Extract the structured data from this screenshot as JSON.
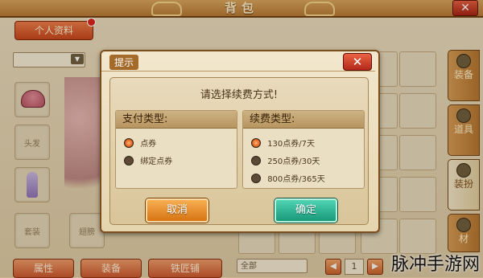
{
  "window": {
    "title": "背包",
    "close_icon": "close-icon"
  },
  "left_panel": {
    "profile_tab_label": "个人资料",
    "slots": {
      "hair_label": "头发",
      "outfit_label": "套装",
      "extra_label": "翅膀"
    }
  },
  "side_tabs": [
    {
      "label": "装备",
      "icon": "equipment-icon"
    },
    {
      "label": "道具",
      "icon": "item-icon"
    },
    {
      "label": "装扮",
      "icon": "costume-icon"
    },
    {
      "label": "材",
      "icon": "material-icon"
    }
  ],
  "bottom_bar": {
    "buttons": [
      "属性",
      "装备",
      "铁匠铺"
    ],
    "filter_value": "全部",
    "page_number": "1"
  },
  "dialog": {
    "title": "提示",
    "prompt": "请选择续费方式!",
    "payment_type": {
      "heading": "支付类型:",
      "options": [
        {
          "label": "点券",
          "selected": true
        },
        {
          "label": "绑定点券",
          "selected": false
        }
      ]
    },
    "renewal_type": {
      "heading": "续费类型:",
      "options": [
        {
          "label": "130点券/7天",
          "selected": true
        },
        {
          "label": "250点券/30天",
          "selected": false
        },
        {
          "label": "800点券/365天",
          "selected": false
        }
      ]
    },
    "cancel_label": "取消",
    "confirm_label": "确定"
  },
  "watermark": "脉冲手游网",
  "colors": {
    "frame": "#b67834",
    "cancel_button": "#d77413",
    "confirm_button": "#18997a",
    "selected_radio": "#e96a24"
  }
}
